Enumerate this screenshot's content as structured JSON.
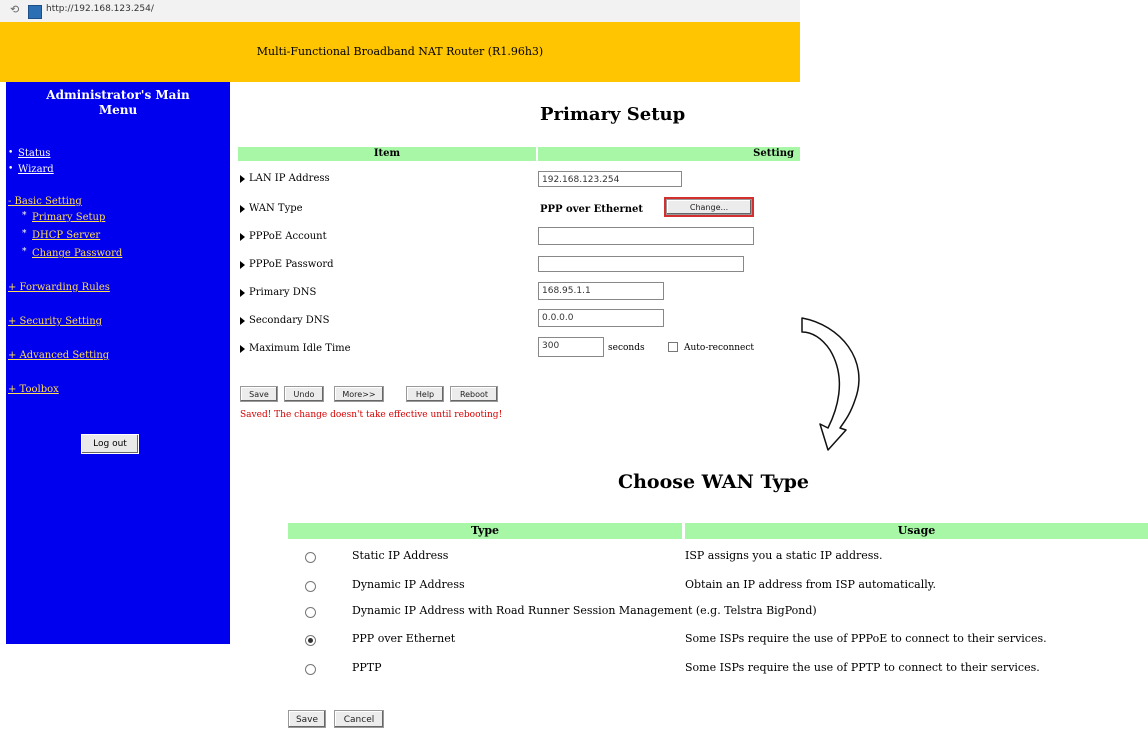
{
  "browser": {
    "url": "http://192.168.123.254/"
  },
  "banner": {
    "title": "Multi-Functional Broadband NAT Router (R1.96h3)"
  },
  "sidebar": {
    "title_line1": "Administrator's Main",
    "title_line2": "Menu",
    "links": {
      "status": "Status",
      "wizard": "Wizard",
      "basic_setting": "- Basic Setting",
      "primary_setup": "Primary Setup",
      "dhcp_server": "DHCP Server",
      "change_password": "Change Password",
      "forwarding_rules": "+ Forwarding Rules",
      "security_setting": "+ Security Setting",
      "advanced_setting": "+ Advanced Setting",
      "toolbox": "+ Toolbox"
    },
    "logout_label": "Log out"
  },
  "primary_setup": {
    "title": "Primary Setup",
    "col_item": "Item",
    "col_setting": "Setting",
    "rows": {
      "lan_ip": {
        "label": "LAN IP Address",
        "value": "192.168.123.254"
      },
      "wan_type": {
        "label": "WAN Type",
        "value": "PPP over Ethernet",
        "button": "Change..."
      },
      "pppoe_account": {
        "label": "PPPoE Account",
        "value": ""
      },
      "pppoe_password": {
        "label": "PPPoE Password",
        "value": ""
      },
      "primary_dns": {
        "label": "Primary DNS",
        "value": "168.95.1.1"
      },
      "secondary_dns": {
        "label": "Secondary DNS",
        "value": "0.0.0.0"
      },
      "max_idle": {
        "label": "Maximum Idle Time",
        "value": "300",
        "unit": "seconds",
        "checkbox_label": "Auto-reconnect"
      }
    },
    "buttons": {
      "save": "Save",
      "undo": "Undo",
      "more": "More>>",
      "help": "Help",
      "reboot": "Reboot"
    },
    "message": "Saved! The change doesn't take effective until rebooting!"
  },
  "choose_wan": {
    "title": "Choose WAN Type",
    "col_type": "Type",
    "col_usage": "Usage",
    "options": [
      {
        "type": "Static IP Address",
        "usage": "ISP assigns you a static IP address.",
        "selected": false
      },
      {
        "type": "Dynamic IP Address",
        "usage": "Obtain an IP address from ISP automatically.",
        "selected": false
      },
      {
        "type": "Dynamic IP Address with Road Runner Session Management (e.g. Telstra BigPond)",
        "usage": "",
        "selected": false
      },
      {
        "type": "PPP over Ethernet",
        "usage": "Some ISPs require the use of PPPoE to connect to their services.",
        "selected": true
      },
      {
        "type": "PPTP",
        "usage": "Some ISPs require the use of PPTP to connect to their services.",
        "selected": false
      }
    ],
    "buttons": {
      "save": "Save",
      "cancel": "Cancel"
    }
  },
  "colors": {
    "banner": "#ffc500",
    "sidebar": "#0000ee",
    "table_header": "#a7f7a7",
    "highlight": "#d32f2f",
    "message": "#d40000"
  }
}
